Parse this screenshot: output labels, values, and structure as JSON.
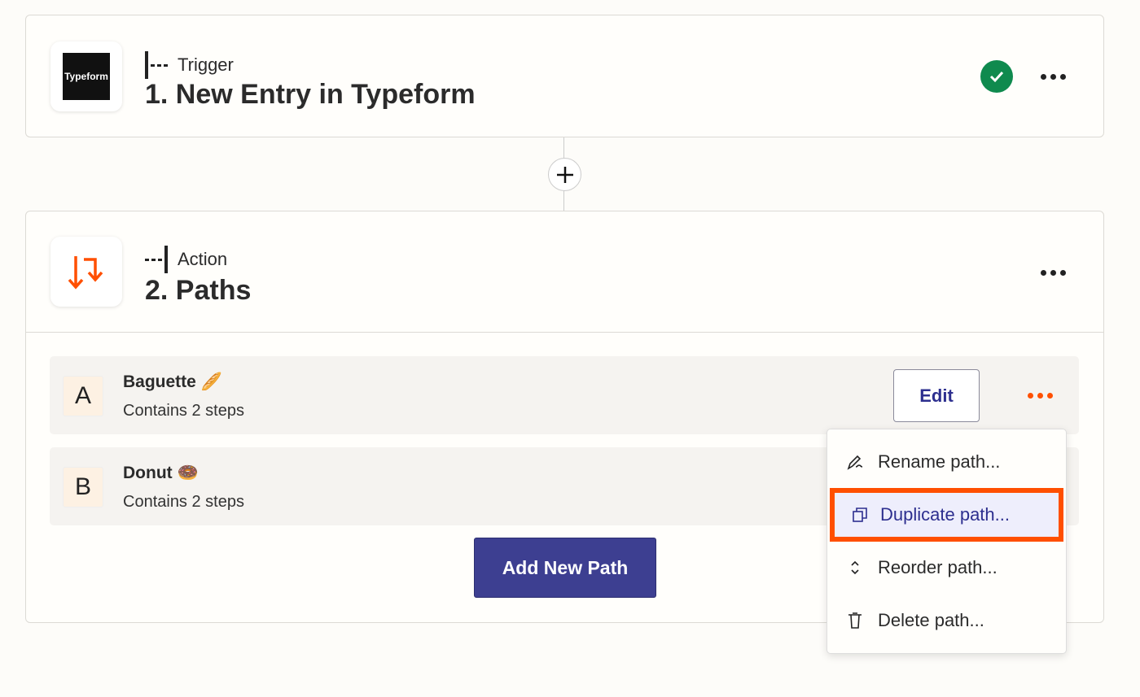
{
  "trigger": {
    "kind": "Trigger",
    "title": "1. New Entry in Typeform",
    "app_logo": "Typeform",
    "status": "check-circle-icon"
  },
  "action": {
    "kind": "Action",
    "title": "2. Paths",
    "icon": "paths-arrows-icon"
  },
  "paths": [
    {
      "letter": "A",
      "name": "Baguette 🥖",
      "sub": "Contains 2 steps"
    },
    {
      "letter": "B",
      "name": "Donut 🍩",
      "sub": "Contains 2 steps"
    }
  ],
  "edit_label": "Edit",
  "add_path_label": "Add New Path",
  "menu": [
    {
      "label": "Rename path...",
      "icon": "pencil-icon"
    },
    {
      "label": "Duplicate path...",
      "icon": "duplicate-icon"
    },
    {
      "label": "Reorder path...",
      "icon": "reorder-icon"
    },
    {
      "label": "Delete path...",
      "icon": "trash-icon"
    }
  ],
  "colors": {
    "accent": "#ff4f00",
    "primary": "#3d3f91",
    "success": "#0f8a4e",
    "highlight_bg": "#eeeefc"
  }
}
